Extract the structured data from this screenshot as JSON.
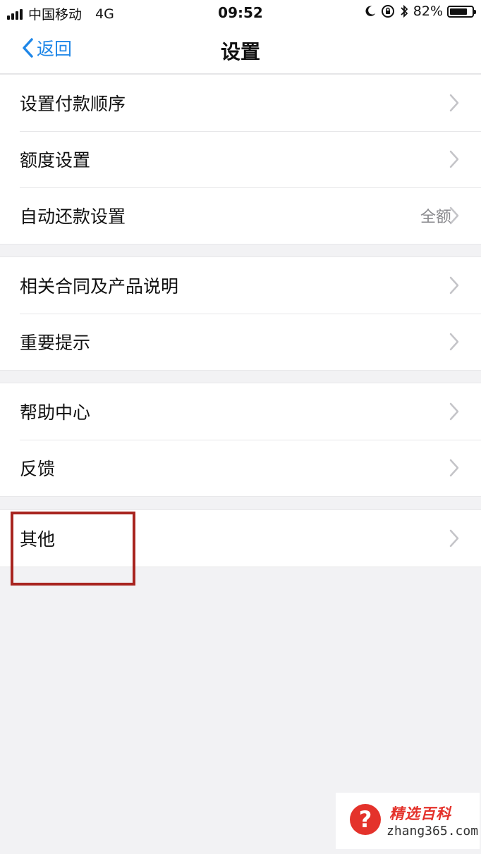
{
  "status_bar": {
    "carrier": "中国移动",
    "network": "4G",
    "time": "09:52",
    "battery": "82%",
    "battery_level": 0.82,
    "icons": [
      "signal-icon",
      "moon-icon",
      "rotation-lock-icon",
      "bluetooth-icon",
      "battery-icon"
    ]
  },
  "nav": {
    "back_label": "返回",
    "title": "设置"
  },
  "groups": [
    {
      "items": [
        {
          "label": "设置付款顺序",
          "value": ""
        },
        {
          "label": "额度设置",
          "value": ""
        },
        {
          "label": "自动还款设置",
          "value": "全额"
        }
      ]
    },
    {
      "items": [
        {
          "label": "相关合同及产品说明",
          "value": ""
        },
        {
          "label": "重要提示",
          "value": ""
        }
      ]
    },
    {
      "items": [
        {
          "label": "帮助中心",
          "value": ""
        },
        {
          "label": "反馈",
          "value": ""
        }
      ]
    },
    {
      "items": [
        {
          "label": "其他",
          "value": ""
        }
      ]
    }
  ],
  "watermark": {
    "title": "精选百科",
    "url": "zhang365.com",
    "icon_symbol": "?"
  },
  "colors": {
    "accent": "#1f87e8",
    "highlight": "#a8241f",
    "watermark_red": "#e4322b",
    "background": "#f2f2f4"
  }
}
